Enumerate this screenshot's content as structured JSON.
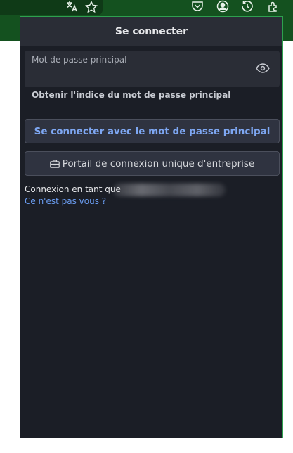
{
  "browser": {
    "accent_color": "#14511f",
    "toolbar_icons": [
      "translate-icon",
      "star-icon",
      "pocket-icon",
      "account-icon",
      "history-icon",
      "extensions-icon"
    ]
  },
  "popup": {
    "title": "Se connecter",
    "password_field": {
      "label": "Mot de passe principal",
      "value": ""
    },
    "hint_link": "Obtenir l'indice du mot de passe principal",
    "primary_button": "Se connecter avec le mot de passe principal",
    "sso_button": "Portail de connexion unique d'entreprise",
    "logged_in_as": "Connexion en tant que",
    "not_you_link": "Ce n'est pas vous ?",
    "colors": {
      "background": "#1b1e26",
      "border": "#2ea04f",
      "link": "#6a9cf0"
    }
  }
}
